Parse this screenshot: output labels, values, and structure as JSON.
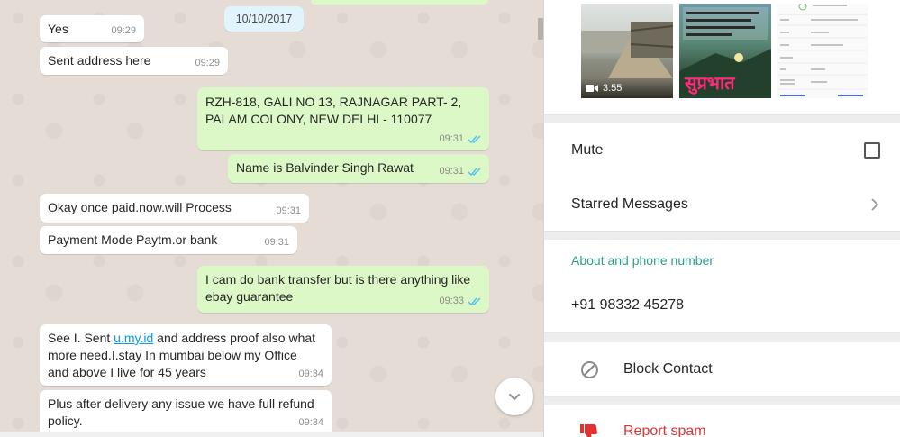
{
  "chat": {
    "date_chip": "10/10/2017",
    "messages": [
      {
        "dir": "in",
        "text": "Yes",
        "time": "09:29"
      },
      {
        "dir": "in",
        "text": "Sent address here",
        "time": "09:29"
      },
      {
        "dir": "out",
        "lines": [
          "RZH-818, GALI NO 13, RAJNAGAR PART- 2,",
          "PALAM COLONY, NEW DELHI - 110077"
        ],
        "time": "09:31",
        "status": "read"
      },
      {
        "dir": "out",
        "text": "Name is Balvinder Singh Rawat",
        "time": "09:31",
        "status": "read"
      },
      {
        "dir": "in",
        "text": "Okay once paid.now.will Process",
        "time": "09:31"
      },
      {
        "dir": "in",
        "text": "Payment Mode Paytm.or bank",
        "time": "09:31"
      },
      {
        "dir": "out",
        "lines": [
          "I cam do bank transfer but is there anything like",
          "ebay guarantee"
        ],
        "time": "09:33",
        "status": "read"
      },
      {
        "dir": "in",
        "prefix": "See I. Sent ",
        "link": "u.my.id",
        "suffix": " and address proof also what",
        "lines_rest": [
          "more need.I.stay In mumbai below my Office",
          "and above I live for 45 years"
        ],
        "time": "09:34"
      },
      {
        "dir": "in",
        "lines": [
          "Plus after delivery any issue we have full refund",
          "policy."
        ],
        "time": "09:34"
      }
    ],
    "tick_color": "#4fc3f7"
  },
  "info": {
    "media": [
      {
        "type": "video",
        "duration": "3:55",
        "icon": "video-camera-icon"
      },
      {
        "type": "image",
        "caption": "सुप्रभात"
      },
      {
        "type": "document"
      }
    ],
    "mute_label": "Mute",
    "starred_label": "Starred Messages",
    "about_label": "About and phone number",
    "phone": "+91 98332 45278",
    "block_label": "Block Contact",
    "report_label": "Report spam"
  },
  "colors": {
    "chat_background": "#e5ddd5",
    "incoming_bubble": "#ffffff",
    "outgoing_bubble": "#dcf8c6",
    "accent_teal": "#2e9c8c",
    "danger": "#df3333"
  }
}
